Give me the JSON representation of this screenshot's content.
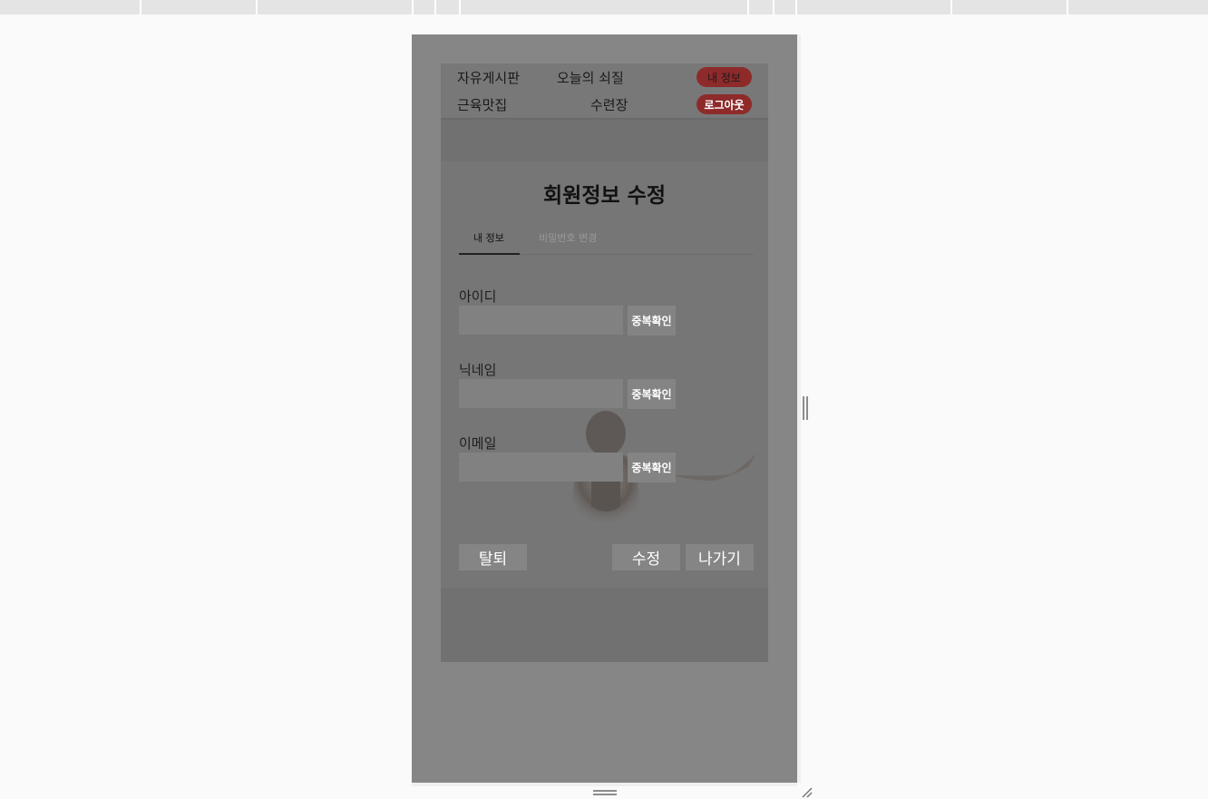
{
  "nav": {
    "links": [
      "자유게시판",
      "오늘의 쇠질",
      "근육맛집",
      "수련장"
    ],
    "my_info_label": "내 정보",
    "logout_label": "로그아웃",
    "pill_color": "#8e2a2a"
  },
  "card": {
    "title": "회원정보 수정",
    "tabs": [
      {
        "label": "내 정보",
        "active": true
      },
      {
        "label": "비밀번호 변경",
        "active": false
      }
    ],
    "fields": [
      {
        "label": "아이디",
        "value": "",
        "button_label": "중복확인"
      },
      {
        "label": "닉네임",
        "value": "",
        "button_label": "중복확인"
      },
      {
        "label": "이메일",
        "value": "",
        "button_label": "중복확인"
      }
    ],
    "actions": {
      "withdraw_label": "탈퇴",
      "edit_label": "수정",
      "exit_label": "나가기"
    }
  }
}
